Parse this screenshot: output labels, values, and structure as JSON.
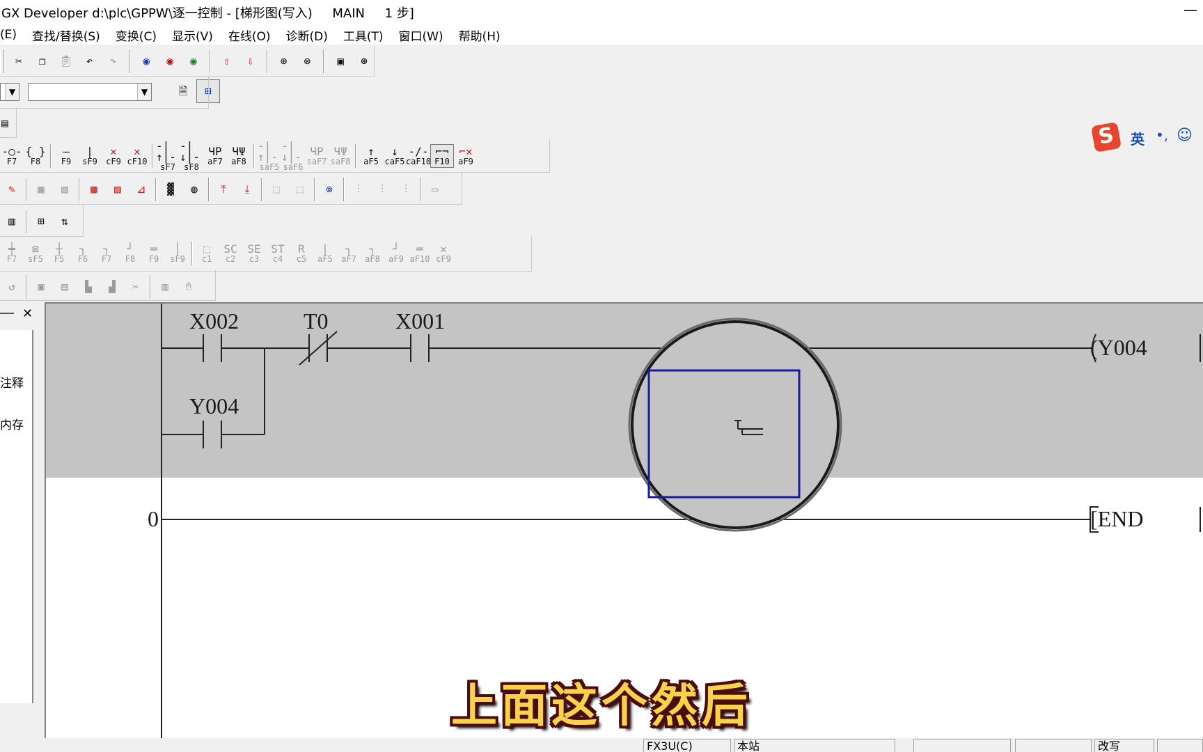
{
  "window": {
    "title": "GX Developer d:\\plc\\GPPW\\逐一控制 - [梯形图(写入)     MAIN     1 步]"
  },
  "menu": [
    "(E)",
    "查找/替换(S)",
    "变换(C)",
    "显示(V)",
    "在线(O)",
    "诊断(D)",
    "工具(T)",
    "窗口(W)",
    "帮助(H)"
  ],
  "toolbar_standard": {
    "buttons": [
      "cut-icon",
      "copy-icon",
      "paste-icon",
      "undo-icon",
      "redo-icon",
      "find-device-icon",
      "find-instruction-icon",
      "find-step-icon",
      "write-plc-icon",
      "read-plc-icon",
      "monitor-start-icon",
      "monitor-stop-icon",
      "program-check-icon",
      "diagnostics-icon"
    ]
  },
  "toolbar_project": {
    "combo_value": ""
  },
  "toolbar_ladder_symbols": {
    "keys": [
      "F7",
      "F8",
      "F9",
      "sF9",
      "cF9",
      "cF10",
      "sF7",
      "sF8",
      "aF7",
      "aF8",
      "saF5",
      "saF6",
      "saF7",
      "saF8",
      "aF5",
      "caF5",
      "caF10",
      "F10",
      "aF9"
    ]
  },
  "toolbar_sfc": {
    "keys": [
      "F7",
      "sF5",
      "F5",
      "F6",
      "F7",
      "F8",
      "F9",
      "sF9",
      "c1",
      "c2",
      "c3",
      "c4",
      "c5",
      "aF5",
      "aF7",
      "aF8",
      "aF9",
      "aF10",
      "cF9"
    ]
  },
  "left_panel": {
    "labels": [
      "注释",
      "内存"
    ]
  },
  "ladder": {
    "rung1": {
      "contacts": [
        "X002",
        "T0",
        "X001"
      ],
      "branch_contact": "Y004",
      "coil": "(Y004"
    },
    "rung2": {
      "step": "0",
      "instruction": "[END"
    }
  },
  "subtitle": "上面这个然后",
  "ime": {
    "logo": "S",
    "mode": "英",
    "punct": "•,",
    "emoji": "☺"
  },
  "status": {
    "cpu": "FX3U(C)",
    "station": "本站",
    "mode": "改写"
  }
}
